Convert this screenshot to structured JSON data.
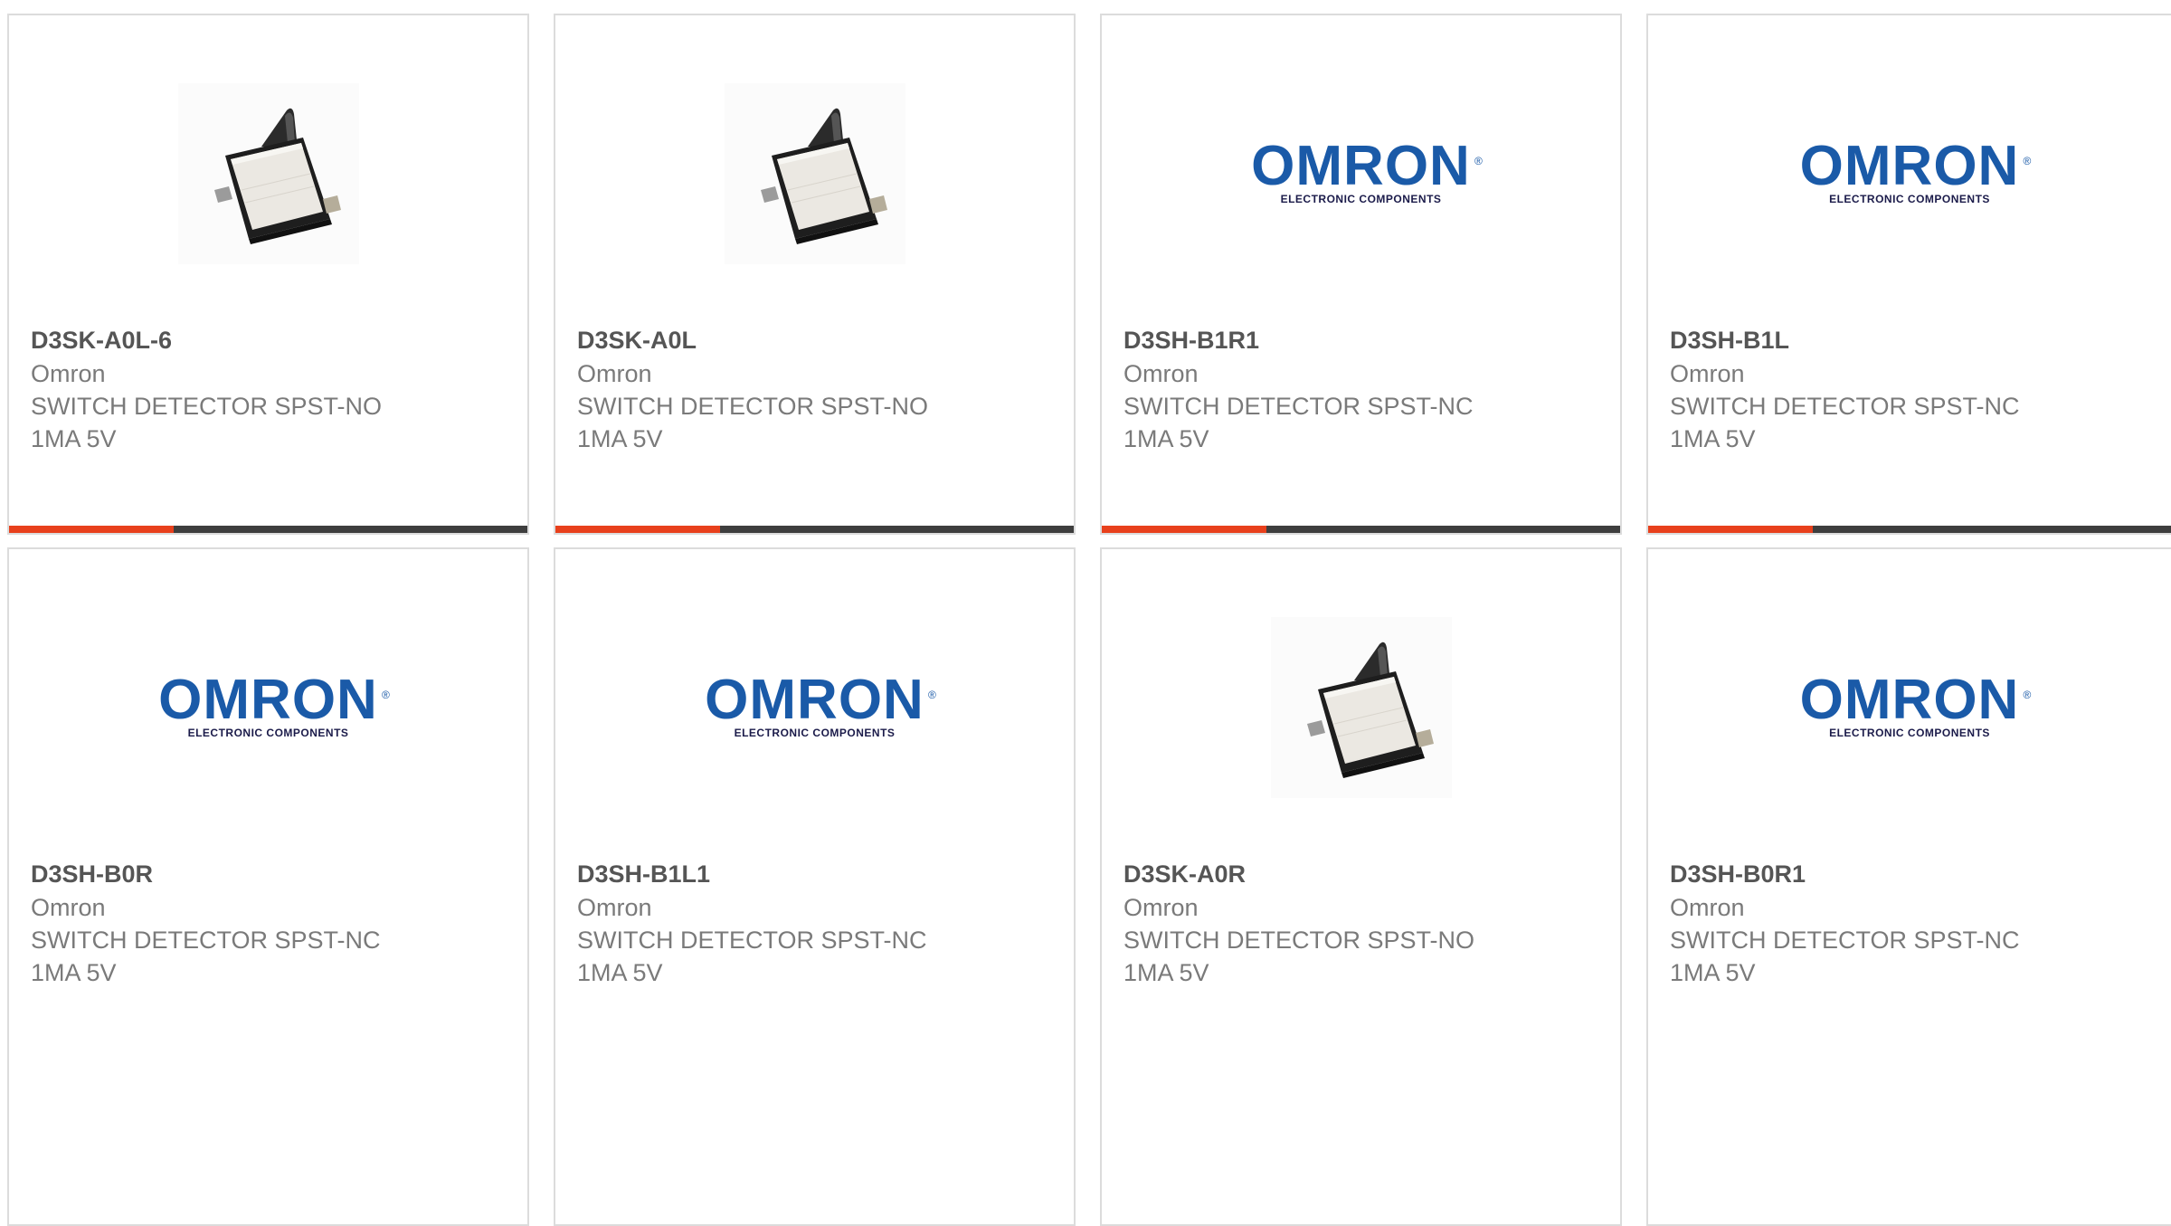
{
  "theme": {
    "accent": "#e8401c",
    "bar": "#3e3e3e",
    "logo_blue": "#1a5aa8",
    "border": "#dcdcdc"
  },
  "products": [
    {
      "part_number": "D3SK-A0L-6",
      "manufacturer": "Omron",
      "description_line1": "SWITCH DETECTOR SPST-NO",
      "description_line2": "1MA 5V",
      "image": "switch-photo"
    },
    {
      "part_number": "D3SK-A0L",
      "manufacturer": "Omron",
      "description_line1": "SWITCH DETECTOR SPST-NO",
      "description_line2": "1MA 5V",
      "image": "switch-photo"
    },
    {
      "part_number": "D3SH-B1R1",
      "manufacturer": "Omron",
      "description_line1": "SWITCH DETECTOR SPST-NC",
      "description_line2": "1MA 5V",
      "image": "omron-logo"
    },
    {
      "part_number": "D3SH-B1L",
      "manufacturer": "Omron",
      "description_line1": "SWITCH DETECTOR SPST-NC",
      "description_line2": "1MA 5V",
      "image": "omron-logo"
    },
    {
      "part_number": "D3SH-B0R",
      "manufacturer": "Omron",
      "description_line1": "SWITCH DETECTOR SPST-NC",
      "description_line2": "1MA 5V",
      "image": "omron-logo"
    },
    {
      "part_number": "D3SH-B1L1",
      "manufacturer": "Omron",
      "description_line1": "SWITCH DETECTOR SPST-NC",
      "description_line2": "1MA 5V",
      "image": "omron-logo"
    },
    {
      "part_number": "D3SK-A0R",
      "manufacturer": "Omron",
      "description_line1": "SWITCH DETECTOR SPST-NO",
      "description_line2": "1MA 5V",
      "image": "switch-photo"
    },
    {
      "part_number": "D3SH-B0R1",
      "manufacturer": "Omron",
      "description_line1": "SWITCH DETECTOR SPST-NC",
      "description_line2": "1MA 5V",
      "image": "omron-logo"
    }
  ],
  "logo": {
    "word": "OMRON",
    "reg_mark": "®",
    "tagline": "ELECTRONIC COMPONENTS"
  }
}
